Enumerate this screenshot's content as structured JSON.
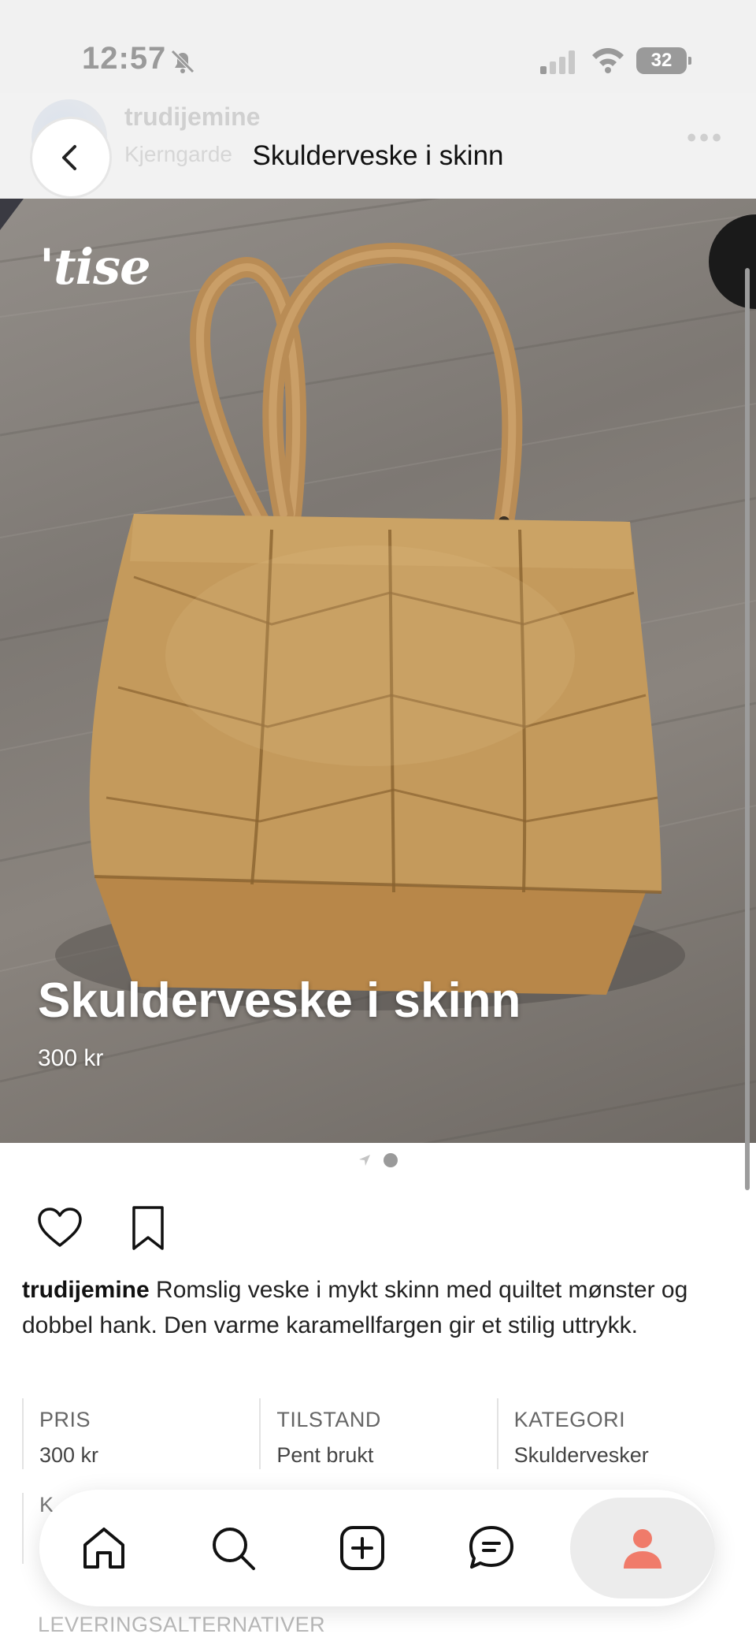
{
  "status_bar": {
    "time": "12:57",
    "battery": "32"
  },
  "header": {
    "title": "Skulderveske i skinn",
    "ghost_username": "trudijemine",
    "ghost_location": "Kjerngarde"
  },
  "photo": {
    "logo": "'tise",
    "title": "Skulderveske i skinn",
    "price": "300 kr",
    "page_count": 2,
    "current_page": 2
  },
  "post": {
    "username": "trudijemine",
    "description": " Romslig veske i mykt skinn med quiltet mønster og dobbel hank. Den varme karamellfargen gir et stilig uttrykk."
  },
  "info": [
    {
      "label": "PRIS",
      "value": "300 kr"
    },
    {
      "label": "TILSTAND",
      "value": "Pent brukt"
    },
    {
      "label": "KATEGORI",
      "value": "Skuldervesker"
    }
  ],
  "info_partial_label": "K",
  "delivery_label": "LEVERINGSALTERNATIVER",
  "nav": {
    "items": [
      "home-icon",
      "search-icon",
      "add-icon",
      "messages-icon",
      "profile-icon"
    ],
    "active": "profile-icon"
  },
  "colors": {
    "accent": "#f07b6a",
    "bag": "#c49a5c",
    "status_gray": "#9a9a9a"
  }
}
